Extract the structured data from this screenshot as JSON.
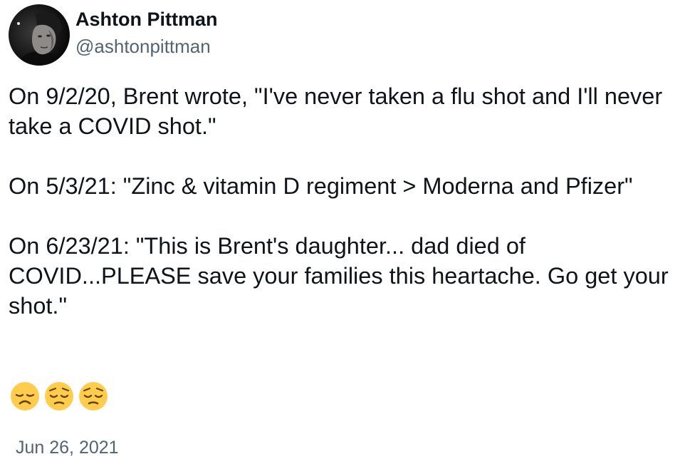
{
  "author": {
    "display_name": "Ashton Pittman",
    "handle": "@ashtonpittman"
  },
  "tweet": {
    "paragraphs": [
      "On 9/2/20, Brent wrote, \"I've never taken a flu shot and I'll never take a COVID shot.\"",
      "On 5/3/21: \"Zinc & vitamin D regiment > Moderna and Pfizer\"",
      "On 6/23/21: \"This is Brent's daughter... dad died of COVID...PLEASE save your families this heartache. Go get your shot.\""
    ],
    "emojis": [
      "disappointed-face-emoji",
      "pensive-face-emoji",
      "pensive-face-emoji"
    ],
    "timestamp": "Jun 26, 2021"
  },
  "colors": {
    "text_primary": "#0f1419",
    "text_secondary": "#536471",
    "emoji_yellow": "#ffcc4d"
  }
}
